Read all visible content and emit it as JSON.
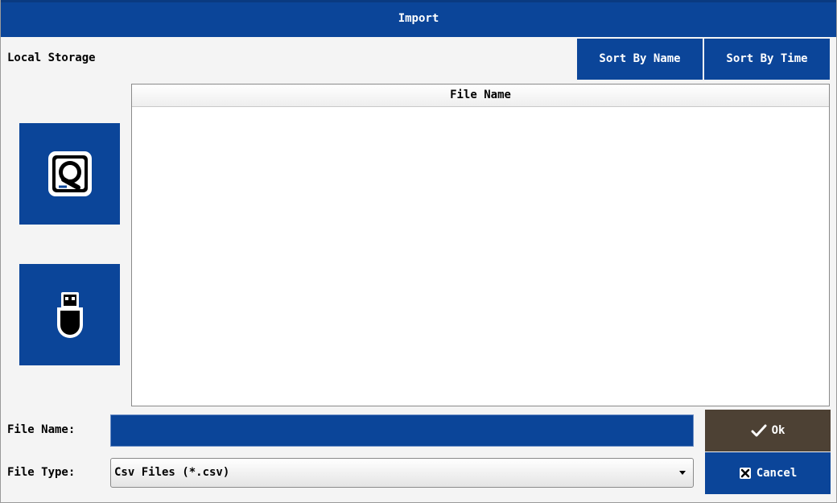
{
  "dialog": {
    "title": "Import",
    "location_label": "Local Storage"
  },
  "sort": {
    "by_name_label": "Sort By Name",
    "by_time_label": "Sort By Time"
  },
  "devices": [
    {
      "name": "local-storage",
      "icon": "hard-drive-icon"
    },
    {
      "name": "usb-storage",
      "icon": "usb-drive-icon"
    }
  ],
  "file_list": {
    "header": "File Name",
    "items": []
  },
  "form": {
    "file_name_label": "File Name:",
    "file_name_value": "",
    "file_type_label": "File Type:",
    "file_type_value": "Csv Files (*.csv)"
  },
  "actions": {
    "ok_label": "Ok",
    "cancel_label": "Cancel"
  },
  "colors": {
    "accent": "#0b4599",
    "ok_button": "#4d4134"
  }
}
